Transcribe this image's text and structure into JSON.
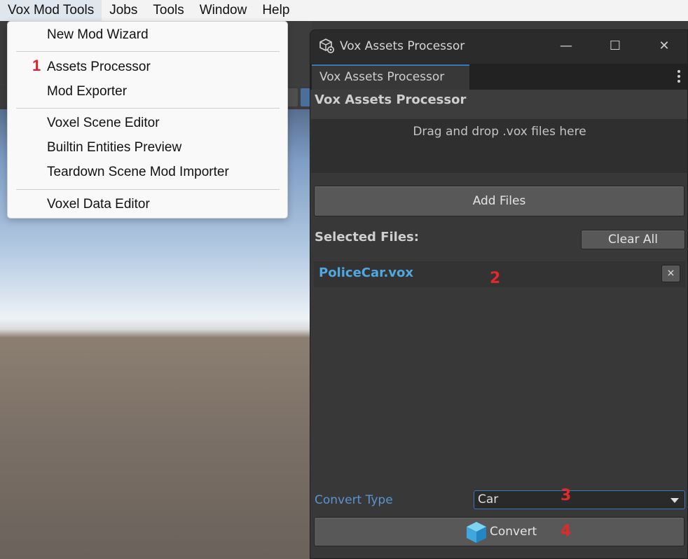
{
  "menubar": {
    "items": [
      "Vox Mod Tools",
      "Jobs",
      "Tools",
      "Window",
      "Help"
    ]
  },
  "dropdown": {
    "items": [
      "New Mod Wizard",
      "Assets Processor",
      "Mod Exporter",
      "Voxel Scene Editor",
      "Builtin Entities Preview",
      "Teardown Scene Mod Importer",
      "Voxel Data Editor"
    ],
    "badge": "1"
  },
  "window": {
    "title": "Vox Assets Processor",
    "controls": {
      "minimize": "—",
      "maximize": "☐",
      "close": "✕"
    },
    "tab": "Vox Assets Processor",
    "header": "Vox Assets Processor",
    "drop_zone_text": "Drag and drop .vox files here",
    "add_files_label": "Add Files",
    "selected_files_label": "Selected Files:",
    "clear_all_label": "Clear All",
    "files": [
      {
        "name": "PoliceCar.vox",
        "remove_label": "×"
      }
    ],
    "convert_type_label": "Convert Type",
    "convert_type_value": "Car",
    "convert_label": "Convert"
  },
  "annotations": [
    "1",
    "2",
    "3",
    "4"
  ],
  "icons": {
    "app": "cube-gear-icon",
    "convert": "cube-icon",
    "kebab": "kebab-menu-icon"
  },
  "colors": {
    "accent_blue": "#3a79bb",
    "file_name": "#4fa8e0",
    "convert_label": "#5c93d1",
    "annotation_red": "#e02a2a"
  }
}
